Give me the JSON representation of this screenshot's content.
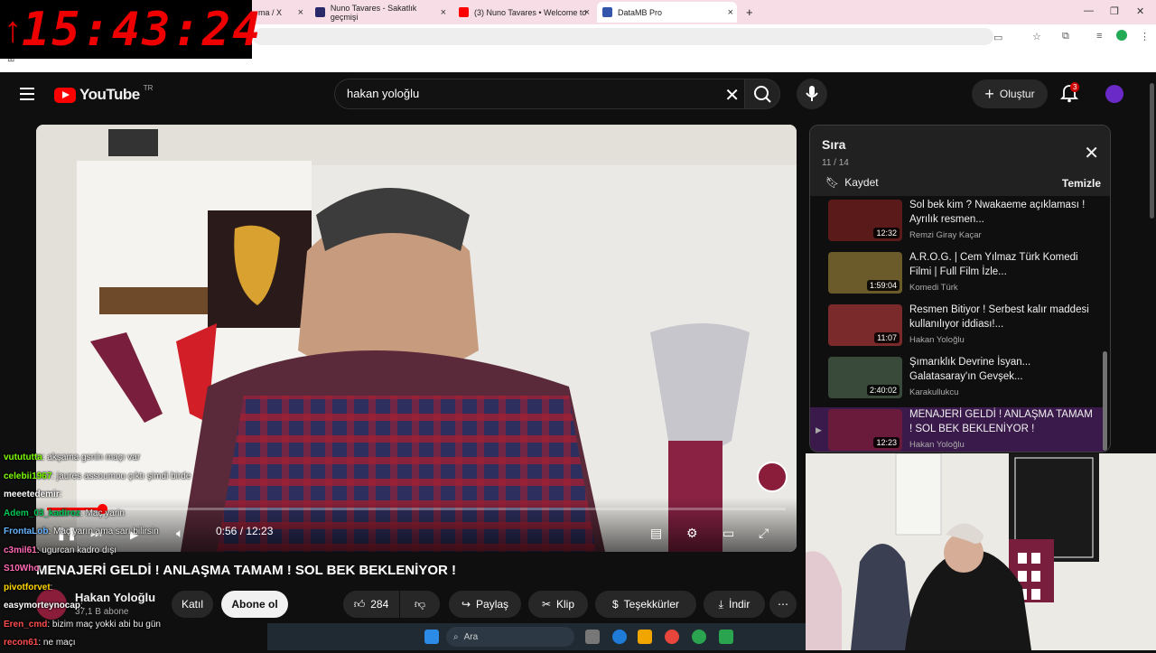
{
  "browser": {
    "tabs": [
      {
        "label": "ma / X"
      },
      {
        "label": "Nuno Tavares - Sakatlık geçmişi"
      },
      {
        "label": "(3) Nuno Tavares • Welcome to"
      },
      {
        "label": "DataMB Pro"
      }
    ],
    "new_tab": "+"
  },
  "clock": {
    "time": "15:43:24"
  },
  "header": {
    "logo_text": "YouTube",
    "country": "TR",
    "search_value": "hakan yoloğlu",
    "create_label": "Oluştur",
    "notif_count": "3"
  },
  "player": {
    "current_time": "0:56",
    "total_time": "12:23",
    "time_display": "0:56 / 12:23",
    "progress": 0.075
  },
  "video": {
    "title": "MENAJERİ GELDİ ! ANLAŞMA TAMAM ! SOL BEK BEKLENİYOR !",
    "channel": "Hakan Yoloğlu",
    "subscribers": "37,1 B abone",
    "join_label": "Katıl",
    "subscribe_label": "Abone ol",
    "likes": "284",
    "share_label": "Paylaş",
    "clip_label": "Klip",
    "thanks_label": "Teşekkürler",
    "download_label": "İndir"
  },
  "chat": [
    {
      "user": "vutututta",
      "color": "#7CFC00",
      "msg": ": akşama gsnin maçı var"
    },
    {
      "user": "celebii1967",
      "color": "#7CFC00",
      "msg": ": jaures assoumou çıktı şimdi birde"
    },
    {
      "user": "meeetedemir",
      "color": "#ffffff",
      "msg": ":"
    },
    {
      "user": "Adem_03_kadiroz",
      "color": "#00c853",
      "msg": ": Maç yarin"
    },
    {
      "user": "FrontaLob",
      "color": "#66b3ff",
      "msg": ": Maç yarın ama sarı bilirsin"
    },
    {
      "user": "c3mil61",
      "color": "#ff69b4",
      "msg": ": ugurcan kadro dışı"
    },
    {
      "user": "S10Who",
      "color": "#ff69b4",
      "msg": ":"
    },
    {
      "user": "pivotforvet",
      "color": "#ffd700",
      "msg": ":"
    },
    {
      "user": "easymorteynocap",
      "color": "#ffffff",
      "msg": ":"
    },
    {
      "user": "Eren_cmd",
      "color": "#ff4d4d",
      "msg": ": bizim maç yokki abi bu gün"
    },
    {
      "user": "recon61",
      "color": "#ff4d4d",
      "msg": ": ne maçı"
    }
  ],
  "playlist": {
    "title": "Sıra",
    "count": "11 / 14",
    "save_label": "Kaydet",
    "clear_label": "Temizle",
    "items": [
      {
        "title": "Sol bek kim ? Nwakaeme açıklaması ! Ayrılık resmen...",
        "channel": "Remzi Giray Kaçar",
        "duration": "12:32",
        "thumb_color": "#5a1a1a"
      },
      {
        "title": "A.R.O.G. | Cem Yılmaz Türk Komedi Filmi | Full Film İzle...",
        "channel": "Komedi Türk",
        "duration": "1:59:04",
        "thumb_color": "#6b5a2a"
      },
      {
        "title": "Resmen Bitiyor ! Serbest kalır maddesi kullanılıyor iddiası!...",
        "channel": "Hakan Yoloğlu",
        "duration": "11:07",
        "thumb_color": "#7a2a2a"
      },
      {
        "title": "Şımarıklık Devrine İsyan... Galatasaray'ın Gevşek...",
        "channel": "Karakullukcu",
        "duration": "2:40:02",
        "thumb_color": "#3a4a3a"
      },
      {
        "title": "MENAJERİ GELDİ ! ANLAŞMA TAMAM ! SOL BEK BEKLENİYOR !",
        "channel": "Hakan Yoloğlu",
        "duration": "12:23",
        "thumb_color": "#6a1a3a"
      }
    ]
  },
  "taskbar": {
    "search_placeholder": "Ara"
  },
  "colors": {
    "accent": "#ff0000",
    "bg": "#0f0f0f",
    "tab_bg": "#f6dde6"
  }
}
